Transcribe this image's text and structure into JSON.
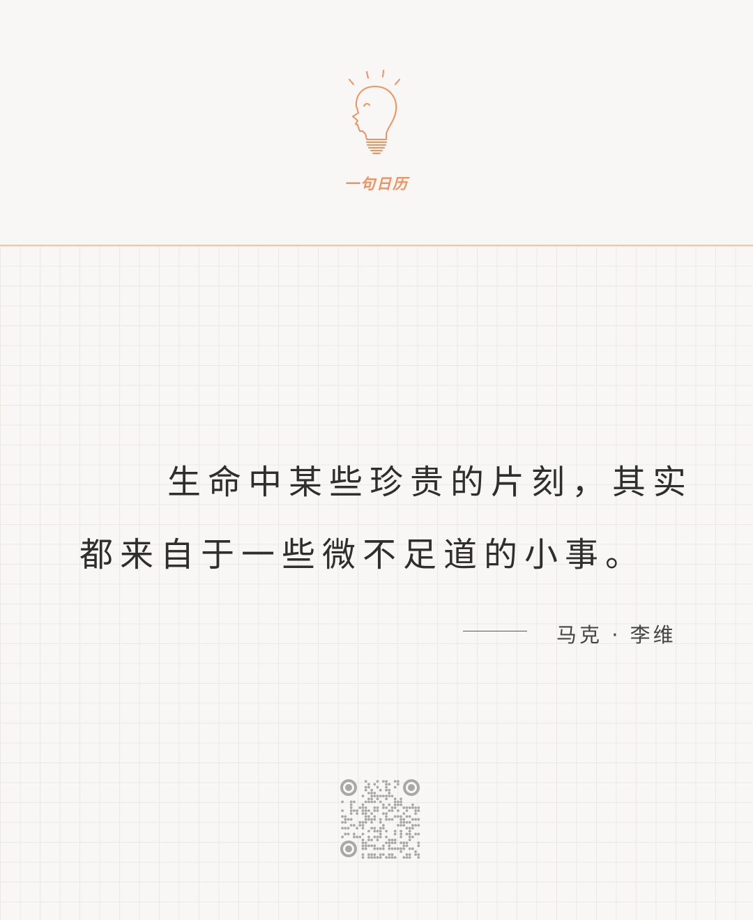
{
  "brand": {
    "name": "一句日历",
    "accent_color": "#f0915f",
    "logo_icon": "lightbulb-head-icon"
  },
  "quote": {
    "line1": "生命中某些珍贵的片刻，其实",
    "line2": "都来自于一些微不足道的小事。"
  },
  "author": {
    "dash": "——",
    "name": "马克 · 李维"
  },
  "qr_code": {
    "icon": "qr-code-icon"
  }
}
